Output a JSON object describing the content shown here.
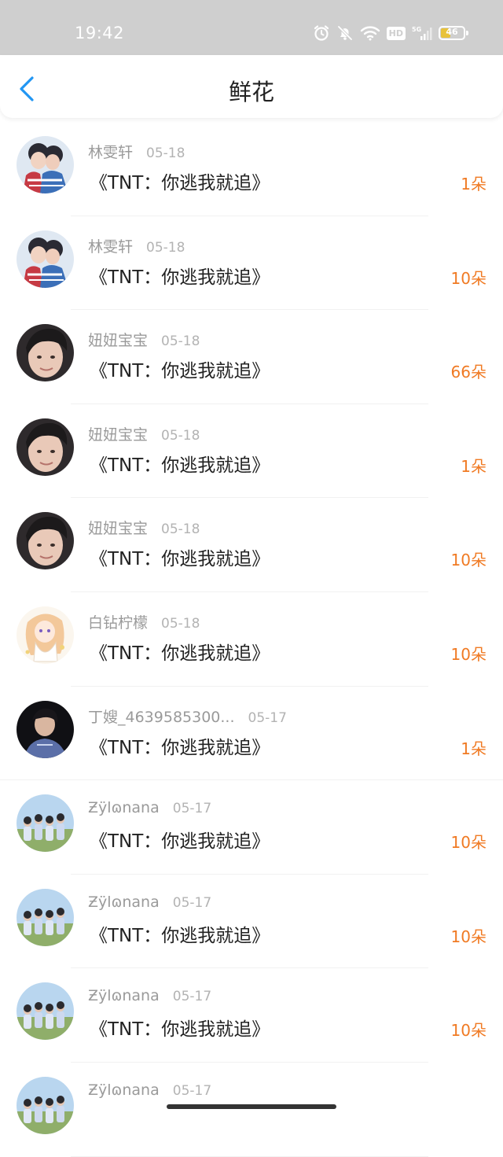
{
  "status_bar": {
    "time": "19:42",
    "network": "5G",
    "hd": "HD",
    "battery": "46",
    "battery_percent": 46
  },
  "header": {
    "title": "鲜花",
    "back_icon": "chevron-left-icon",
    "accent_color": "#2196f3"
  },
  "colors": {
    "amount": "#f07a23",
    "name": "#9a9a9a"
  },
  "records": [
    {
      "name": "林雯轩",
      "date": "05-18",
      "title": "《TNT：你逃我就追》",
      "amount": "1朵"
    },
    {
      "name": "林雯轩",
      "date": "05-18",
      "title": "《TNT：你逃我就追》",
      "amount": "10朵"
    },
    {
      "name": "妞妞宝宝",
      "date": "05-18",
      "title": "《TNT：你逃我就追》",
      "amount": "66朵"
    },
    {
      "name": "妞妞宝宝",
      "date": "05-18",
      "title": "《TNT：你逃我就追》",
      "amount": "1朵"
    },
    {
      "name": "妞妞宝宝",
      "date": "05-18",
      "title": "《TNT：你逃我就追》",
      "amount": "10朵"
    },
    {
      "name": "白钻柠檬",
      "date": "05-18",
      "title": "《TNT：你逃我就追》",
      "amount": "10朵"
    },
    {
      "name": "丁嫂_4639585300...",
      "date": "05-17",
      "title": "《TNT：你逃我就追》",
      "amount": "1朵"
    },
    {
      "name": "Ƶÿlɷnana",
      "date": "05-17",
      "title": "《TNT：你逃我就追》",
      "amount": "10朵"
    },
    {
      "name": "Ƶÿlɷnana",
      "date": "05-17",
      "title": "《TNT：你逃我就追》",
      "amount": "10朵"
    },
    {
      "name": "Ƶÿlɷnana",
      "date": "05-17",
      "title": "《TNT：你逃我就追》",
      "amount": "10朵"
    },
    {
      "name": "Ƶÿlɷnana",
      "date": "05-17",
      "title": "",
      "amount": ""
    }
  ]
}
